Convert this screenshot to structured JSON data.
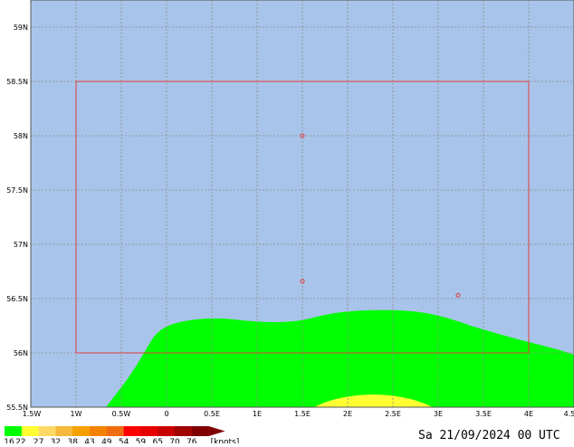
{
  "map": {
    "colors": {
      "sea": "#a8c4ea",
      "grid": "#8c8c8c",
      "area_box": "#e23b3b",
      "point": "#e23b3b"
    },
    "lat_labels": [
      "59N",
      "58.5N",
      "58N",
      "57.5N",
      "57N",
      "56.5N",
      "56N",
      "55.5N"
    ],
    "lon_labels": [
      "1.5W",
      "1W",
      "0.5W",
      "0",
      "0.5E",
      "1E",
      "1.5E",
      "2E",
      "2.5E",
      "3E",
      "3.5E",
      "4E",
      "4.5"
    ],
    "area_box": {
      "lon_min": -1.0,
      "lon_max": 4.0,
      "lat_min": 56.0,
      "lat_max": 58.5
    },
    "points": [
      {
        "lon": 1.5,
        "lat": 58.0
      },
      {
        "lon": 1.5,
        "lat": 56.66
      },
      {
        "lon": 3.22,
        "lat": 56.53
      }
    ],
    "fields": [
      {
        "band": "16-22",
        "color": "#00ff00"
      },
      {
        "band": "22-27",
        "color": "#ffff33"
      }
    ]
  },
  "legend": {
    "values": [
      "16",
      "22",
      "27",
      "32",
      "38",
      "43",
      "49",
      "54",
      "59",
      "65",
      "70",
      "76"
    ],
    "colors": [
      "#00ff00",
      "#ffff33",
      "#ffd966",
      "#f4b93a",
      "#f6a000",
      "#f48200",
      "#f06c10",
      "#ff0000",
      "#e60000",
      "#c80000",
      "#a00000",
      "#800000"
    ],
    "unit": "[knots]"
  },
  "valid_time": "Sa 21/09/2024 00 UTC"
}
